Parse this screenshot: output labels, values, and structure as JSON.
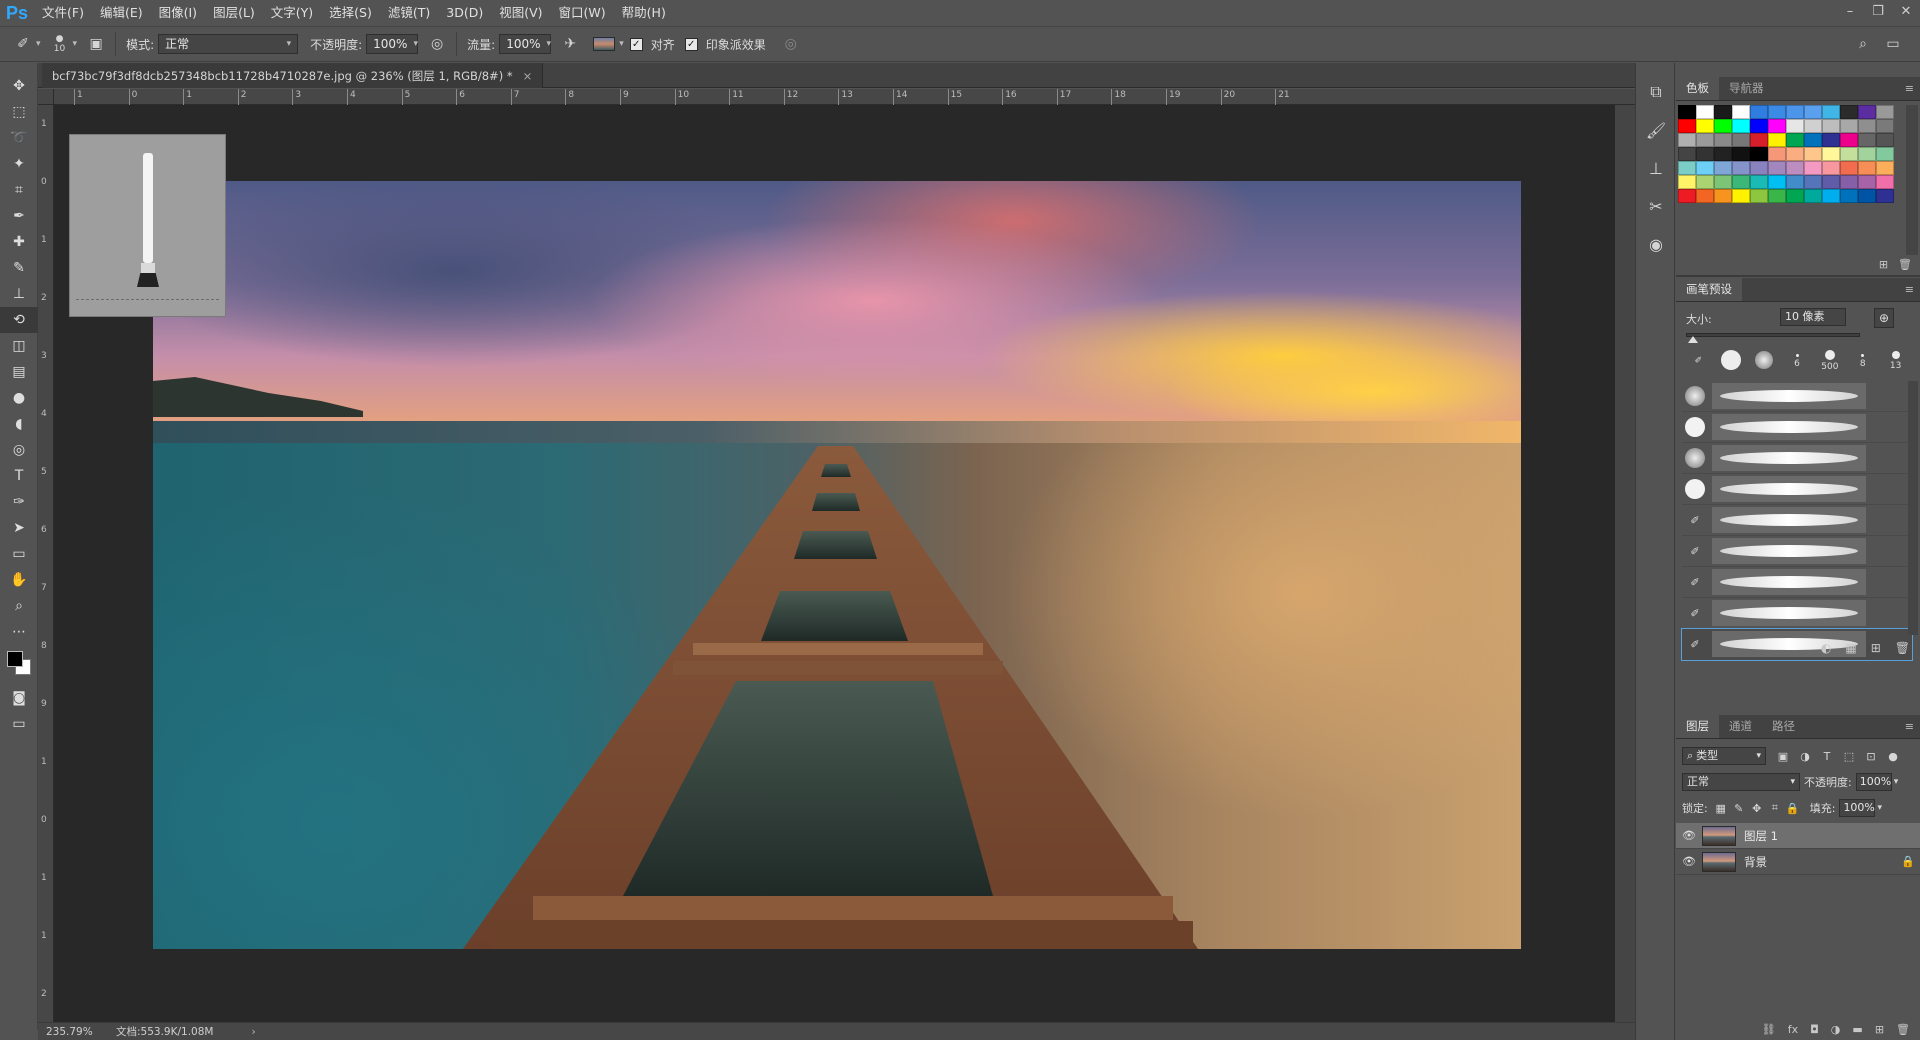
{
  "app": {
    "logo": "Ps"
  },
  "menu": [
    "文件(F)",
    "编辑(E)",
    "图像(I)",
    "图层(L)",
    "文字(Y)",
    "选择(S)",
    "滤镜(T)",
    "3D(D)",
    "视图(V)",
    "窗口(W)",
    "帮助(H)"
  ],
  "options": {
    "brush_size": "10",
    "mode_label": "模式:",
    "mode_value": "正常",
    "opacity_label": "不透明度:",
    "opacity_value": "100%",
    "flow_label": "流量:",
    "flow_value": "100%",
    "aligned_label": "对齐",
    "aligned_checked": true,
    "impressionist_label": "印象派效果",
    "impressionist_checked": true
  },
  "tools": [
    "move-tool",
    "marquee-tool",
    "lasso-tool",
    "magic-wand-tool",
    "crop-tool",
    "eyedropper-tool",
    "healing-brush-tool",
    "brush-tool",
    "clone-stamp-tool",
    "history-brush-tool",
    "eraser-tool",
    "gradient-tool",
    "blur-tool",
    "dodge-tool",
    "sponge-tool",
    "type-tool",
    "pen-tool",
    "path-selection-tool",
    "rectangle-tool",
    "hand-tool",
    "zoom-tool",
    "more-tools"
  ],
  "active_tool": "history-brush-tool",
  "document": {
    "tab_title": "bcf73bc79f3df8dcb257348bcb11728b4710287e.jpg @ 236% (图层 1, RGB/8#) *",
    "close": "×"
  },
  "ruler_h": [
    "1",
    "0",
    "1",
    "2",
    "3",
    "4",
    "5",
    "6",
    "7",
    "8",
    "9",
    "10",
    "11",
    "12",
    "13",
    "14",
    "15",
    "16",
    "17",
    "18",
    "19",
    "20",
    "21"
  ],
  "ruler_v": [
    "1",
    "0",
    "1",
    "2",
    "3",
    "4",
    "5",
    "6",
    "7",
    "8",
    "9",
    "1",
    "0",
    "1",
    "1",
    "2"
  ],
  "status": {
    "zoom": "235.79%",
    "doc": "文档:553.9K/1.08M"
  },
  "swatches_panel": {
    "tabs": [
      "色板",
      "导航器"
    ],
    "colors": [
      "#000000",
      "#ffffff",
      "#1a1a1a",
      "#ffffff",
      "#2f7de0",
      "#3a8ae6",
      "#4b96ea",
      "#5aa0ee",
      "#3fb6e6",
      "#2b2b2b",
      "#5a2da0",
      "#999999",
      "#ff0000",
      "#ffff00",
      "#00ff00",
      "#00ffff",
      "#0000ff",
      "#ff00ff",
      "#e6e6e6",
      "#d0d0d0",
      "#bdbdbd",
      "#a8a8a8",
      "#8f8f8f",
      "#7a7a7a",
      "#b0b0b0",
      "#9a9a9a",
      "#8a8a8a",
      "#777777",
      "#d61f2b",
      "#ffef00",
      "#00a651",
      "#0072bc",
      "#2e3192",
      "#ec008c",
      "#666666",
      "#555555",
      "#444444",
      "#333333",
      "#222222",
      "#111111",
      "#000000",
      "#f7977a",
      "#f9ad81",
      "#fdc68a",
      "#fff79a",
      "#c4df9b",
      "#a3d39c",
      "#82ca9d",
      "#7bcdc8",
      "#6ecff6",
      "#7ea7d8",
      "#8493ca",
      "#8882be",
      "#a187be",
      "#bc8dbf",
      "#f49ac2",
      "#f6989d",
      "#f26c4f",
      "#f68e55",
      "#fbaf5c",
      "#fff467",
      "#acd372",
      "#7cc576",
      "#3bb878",
      "#1abbb4",
      "#00bff3",
      "#438cca",
      "#5574b9",
      "#605ca8",
      "#855fa8",
      "#a763a8",
      "#f06ea9",
      "#ed1c24",
      "#f26522",
      "#f7941d",
      "#fff200",
      "#8dc73f",
      "#39b54a",
      "#00a651",
      "#00a99d",
      "#00aeef",
      "#0072bc",
      "#0054a6",
      "#2e3192"
    ]
  },
  "brush_panel": {
    "title": "画笔预设",
    "size_label": "大小:",
    "size_value": "10 像素",
    "tips": [
      {
        "label": ""
      },
      {
        "label": ""
      },
      {
        "label": "6"
      },
      {
        "label": "500"
      },
      {
        "label": "8"
      },
      {
        "label": "13"
      }
    ],
    "rows": 9,
    "selected_row": 8
  },
  "layers_panel": {
    "tabs": [
      "图层",
      "通道",
      "路径"
    ],
    "filter": "类型",
    "blend_mode": "正常",
    "opacity_label": "不透明度:",
    "opacity_value": "100%",
    "lock_label": "锁定:",
    "fill_label": "填充:",
    "fill_value": "100%",
    "layers": [
      {
        "name": "图层 1",
        "selected": true,
        "locked": false
      },
      {
        "name": "背景",
        "selected": false,
        "locked": true
      }
    ]
  }
}
